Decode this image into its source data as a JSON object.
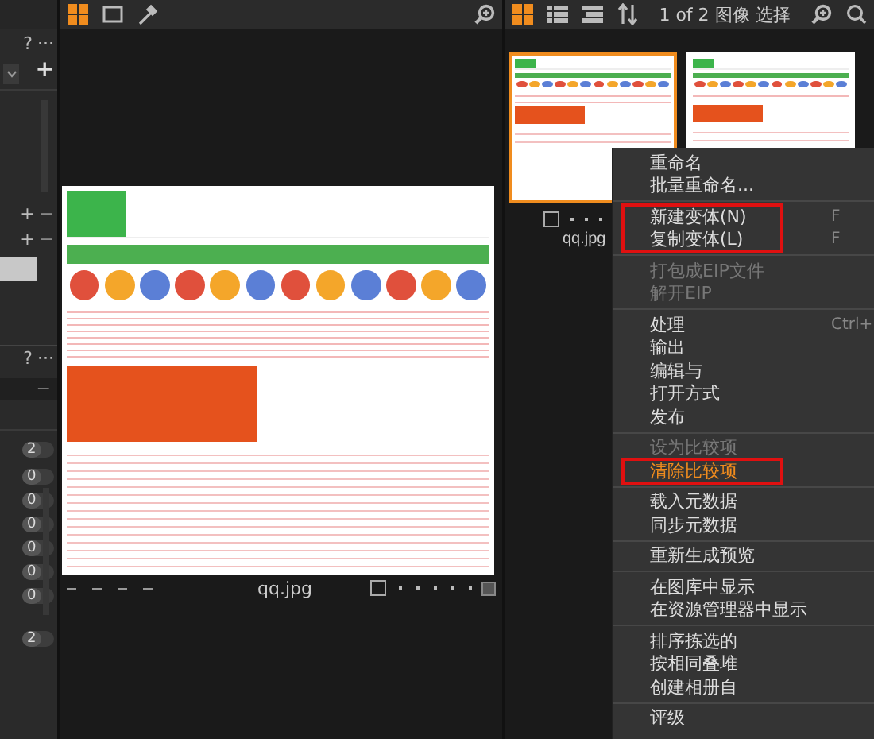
{
  "left_panel": {
    "top_header": {
      "help": "?",
      "more": "···"
    },
    "add_button": "+",
    "list_controls": [
      {
        "add": "+",
        "remove": "−"
      },
      {
        "add": "+",
        "remove": "−"
      }
    ],
    "bottom_header": {
      "help": "?",
      "more": "···"
    },
    "field_button": "−",
    "toggles": [
      {
        "count": "2"
      },
      {
        "count": "0"
      },
      {
        "count": "0"
      },
      {
        "count": "0"
      },
      {
        "count": "0"
      },
      {
        "count": "0"
      },
      {
        "count": "0"
      }
    ],
    "toggles_lower": [
      {
        "count": "2"
      }
    ]
  },
  "viewer": {
    "toolbar": [
      {
        "kind": "grid",
        "selected": true
      },
      {
        "kind": "single",
        "selected": false
      },
      {
        "kind": "picker",
        "selected": false
      }
    ],
    "footer": {
      "file_name": "qq.jpg",
      "checked": false
    }
  },
  "browser": {
    "toolbar": [
      {
        "kind": "grid",
        "selected": true
      },
      {
        "kind": "list",
        "selected": false
      },
      {
        "kind": "details",
        "selected": false
      },
      {
        "kind": "sort",
        "selected": false
      }
    ],
    "count_label": "1 of 2 图像 选择",
    "thumbnails": [
      {
        "name": "qq.jpg",
        "selected": true,
        "checked": false
      },
      {
        "selected": false
      }
    ]
  },
  "context_menu": {
    "sections": [
      [
        {
          "label": "重命名",
          "disabled": false
        },
        {
          "label": "批量重命名...",
          "disabled": false
        }
      ],
      [
        {
          "label": "新建变体(N)",
          "disabled": false,
          "shortcut": "F",
          "annotated": true
        },
        {
          "label": "复制变体(L)",
          "disabled": false,
          "shortcut": "F",
          "annotated": true
        }
      ],
      [
        {
          "label": "打包成EIP文件",
          "disabled": true
        },
        {
          "label": "解开EIP",
          "disabled": true
        }
      ],
      [
        {
          "label": "处理",
          "disabled": false,
          "shortcut": "Ctrl+"
        },
        {
          "label": "输出",
          "disabled": false
        },
        {
          "label": "编辑与",
          "disabled": false
        },
        {
          "label": "打开方式",
          "disabled": false
        },
        {
          "label": "发布",
          "disabled": false
        }
      ],
      [
        {
          "label": "设为比较项",
          "disabled": true
        },
        {
          "label": "清除比较项",
          "disabled": false,
          "highlighted": true,
          "annotated": true
        }
      ],
      [
        {
          "label": "载入元数据",
          "disabled": false
        },
        {
          "label": "同步元数据",
          "disabled": false
        }
      ],
      [
        {
          "label": "重新生成预览",
          "disabled": false
        }
      ],
      [
        {
          "label": "在图库中显示",
          "disabled": false
        },
        {
          "label": "在资源管理器中显示",
          "disabled": false
        }
      ],
      [
        {
          "label": "排序拣选的",
          "disabled": false
        },
        {
          "label": "按相同叠堆",
          "disabled": false
        },
        {
          "label": "创建相册自",
          "disabled": false
        }
      ],
      [
        {
          "label": "评级",
          "disabled": false
        }
      ]
    ]
  }
}
